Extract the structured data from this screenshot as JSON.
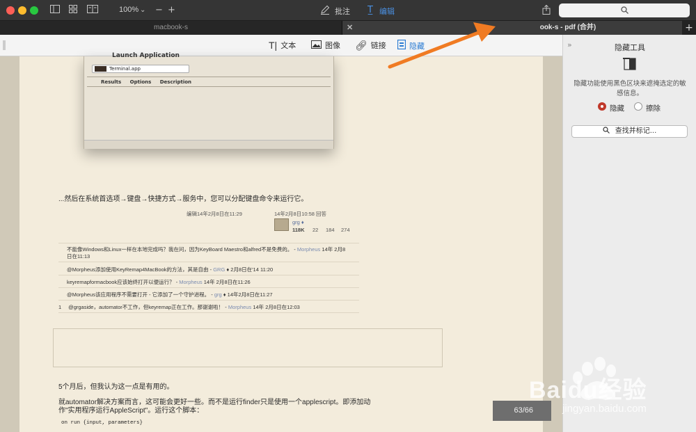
{
  "toolbar": {
    "zoom": "100%",
    "annotate_label": "批注",
    "edit_label": "编辑",
    "search_icon": "search-icon"
  },
  "tabs": [
    {
      "label": "macbook-s"
    },
    {
      "label": "ook-s - pdf  (合并)"
    }
  ],
  "edit_tools": {
    "text": "文本",
    "image": "图像",
    "link": "链接",
    "redact": "隐藏"
  },
  "document": {
    "screenshot": {
      "title": "Launch Application",
      "select_value": "Terminal.app",
      "tabs": [
        "Results",
        "Options",
        "Description"
      ]
    },
    "para1": "...然后在系统首选项→键盘→快捷方式→服务中，您可以分配键盘命令来运行它。",
    "edited": "编辑14年2月8日在11:29",
    "answered": "14年2月8日10:58 回答",
    "user": "grg",
    "rep": "118K",
    "b1": "22",
    "b2": "184",
    "b3": "274",
    "comments": [
      {
        "num": "",
        "text": "不能像Windows和Linux一样在本地完成吗？我在问，因为KeyBoard Maestro和alfred不是免费的。 -",
        "user": "Morpheus",
        "time": "14年  2月8",
        "line2": "日在11:13"
      },
      {
        "num": "",
        "text": "@Morpheus添加使用KeyRemap4MacBook的方法，其是自由 -",
        "user": "GRG",
        "time": "♦ 2月8日在'14 11:20"
      },
      {
        "num": "",
        "text": "keyremapformacbook应该始终打开以便运行？ -",
        "user": "Morpheus",
        "time": "14年  2月8日在11:26"
      },
      {
        "num": "",
        "text": "@Morpheus该应用程序不需要打开 - 它添加了一个守护进程。 -",
        "user": "grg",
        "time": "♦ 14年2月8日在11:27"
      },
      {
        "num": "1",
        "text": "@grgaside，automator不工作，但keyremap正在工作。那谢谢啦！ -",
        "user": "Morpheus",
        "time": "14年  2月8日在12:03"
      }
    ],
    "para2": "5个月后，但我认为这一点是有用的。",
    "para3_line1": "就automator解决方案而言，这可能会更好一些。而不是运行finder只是使用一个applescript。即添加动",
    "para3_line2": "作\"实用程序运行AppleScript\"。运行这个脚本：",
    "code": "on run {input, parameters}"
  },
  "page_indicator": "63/66",
  "sidebar": {
    "title": "隐藏工具",
    "description": "隐藏功能使用黑色区块来遮掩选定的敏感信息。",
    "option_redact": "隐藏",
    "option_erase": "擦除",
    "find_button": "查找并标记..."
  },
  "watermark": {
    "brand": "Baidu经验",
    "url": "jingyan.baidu.com"
  },
  "colors": {
    "accent": "#2a7bd3",
    "radio_selected": "#c0392b",
    "arrow": "#f07b23",
    "page_bg": "#f3ecdc"
  }
}
